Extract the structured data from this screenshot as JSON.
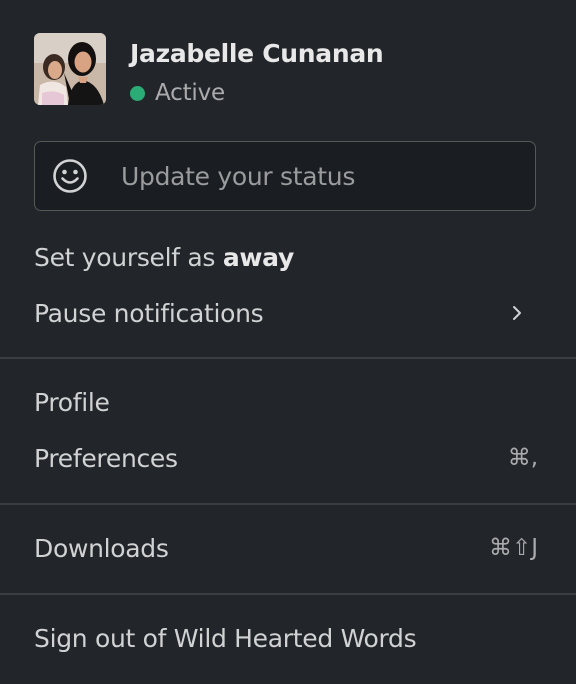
{
  "user": {
    "name": "Jazabelle Cunanan",
    "status": "Active",
    "status_color": "#2bac76"
  },
  "status_input": {
    "placeholder": "Update your status",
    "icon": "smiley-icon"
  },
  "menu": {
    "away_prefix": "Set yourself as ",
    "away_bold": "away",
    "pause": "Pause notifications",
    "pause_icon": "chevron-right-icon",
    "profile": "Profile",
    "preferences": "Preferences",
    "preferences_shortcut": "⌘,",
    "downloads": "Downloads",
    "downloads_shortcut": "⌘⇧J",
    "sign_out": "Sign out of Wild Hearted Words"
  },
  "colors": {
    "background": "#222529",
    "divider": "#3b3d41",
    "text": "#d1d2d3"
  }
}
